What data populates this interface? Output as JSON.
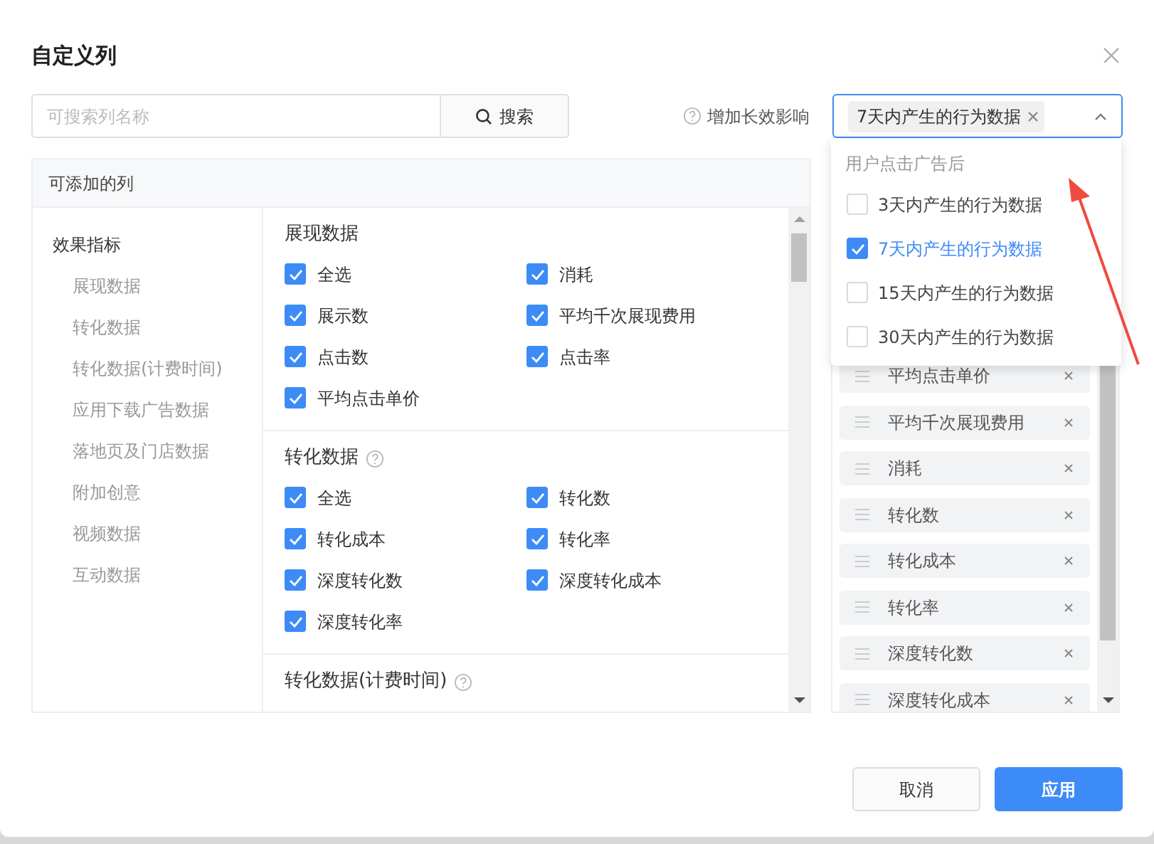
{
  "dialog": {
    "title": "自定义列"
  },
  "search": {
    "placeholder": "可搜索列名称",
    "button": "搜索"
  },
  "long_effect": {
    "label": "增加长效影响"
  },
  "select": {
    "expanded": true,
    "tags": [
      {
        "label": "7天内产生的行为数据"
      }
    ]
  },
  "dropdown": {
    "group": "用户点击广告后",
    "options": [
      {
        "label": "3天内产生的行为数据",
        "checked": false
      },
      {
        "label": "7天内产生的行为数据",
        "checked": true
      },
      {
        "label": "15天内产生的行为数据",
        "checked": false
      },
      {
        "label": "30天内产生的行为数据",
        "checked": false
      }
    ]
  },
  "available": {
    "title": "可添加的列",
    "nav": [
      {
        "label": "效果指标",
        "children": [
          {
            "label": "展现数据"
          },
          {
            "label": "转化数据"
          },
          {
            "label": "转化数据(计费时间)"
          },
          {
            "label": "应用下载广告数据"
          },
          {
            "label": "落地页及门店数据"
          },
          {
            "label": "附加创意"
          },
          {
            "label": "视频数据"
          },
          {
            "label": "互动数据"
          }
        ]
      }
    ],
    "sections": [
      {
        "title": "展现数据",
        "help": false,
        "options": [
          {
            "label": "全选",
            "checked": true
          },
          {
            "label": "消耗",
            "checked": true
          },
          {
            "label": "展示数",
            "checked": true
          },
          {
            "label": "平均千次展现费用",
            "checked": true
          },
          {
            "label": "点击数",
            "checked": true
          },
          {
            "label": "点击率",
            "checked": true
          },
          {
            "label": "平均点击单价",
            "checked": true
          }
        ]
      },
      {
        "title": "转化数据",
        "help": true,
        "options": [
          {
            "label": "全选",
            "checked": true
          },
          {
            "label": "转化数",
            "checked": true
          },
          {
            "label": "转化成本",
            "checked": true
          },
          {
            "label": "转化率",
            "checked": true
          },
          {
            "label": "深度转化数",
            "checked": true
          },
          {
            "label": "深度转化成本",
            "checked": true
          },
          {
            "label": "深度转化率",
            "checked": true
          }
        ]
      },
      {
        "title": "转化数据(计费时间)",
        "help": true
      }
    ]
  },
  "selected_columns": [
    {
      "label": "平均点击单价"
    },
    {
      "label": "平均千次展现费用"
    },
    {
      "label": "消耗"
    },
    {
      "label": "转化数"
    },
    {
      "label": "转化成本"
    },
    {
      "label": "转化率"
    },
    {
      "label": "深度转化数"
    },
    {
      "label": "深度转化成本"
    }
  ],
  "buttons": {
    "cancel": "取消",
    "apply": "应用"
  }
}
